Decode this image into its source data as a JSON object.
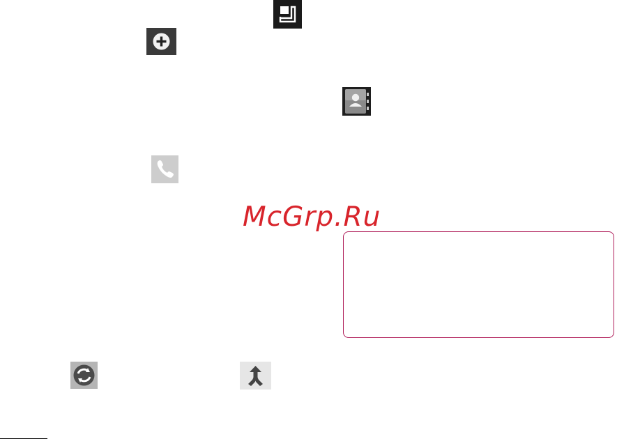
{
  "watermark": {
    "text": "McGrp.Ru",
    "color": "#d8242b"
  },
  "icons": [
    {
      "name": "widget-icon"
    },
    {
      "name": "add-icon"
    },
    {
      "name": "contacts-icon"
    },
    {
      "name": "phone-icon"
    },
    {
      "name": "sync-icon"
    },
    {
      "name": "merge-icon"
    }
  ],
  "colors": {
    "note_border": "#b01e5a"
  }
}
